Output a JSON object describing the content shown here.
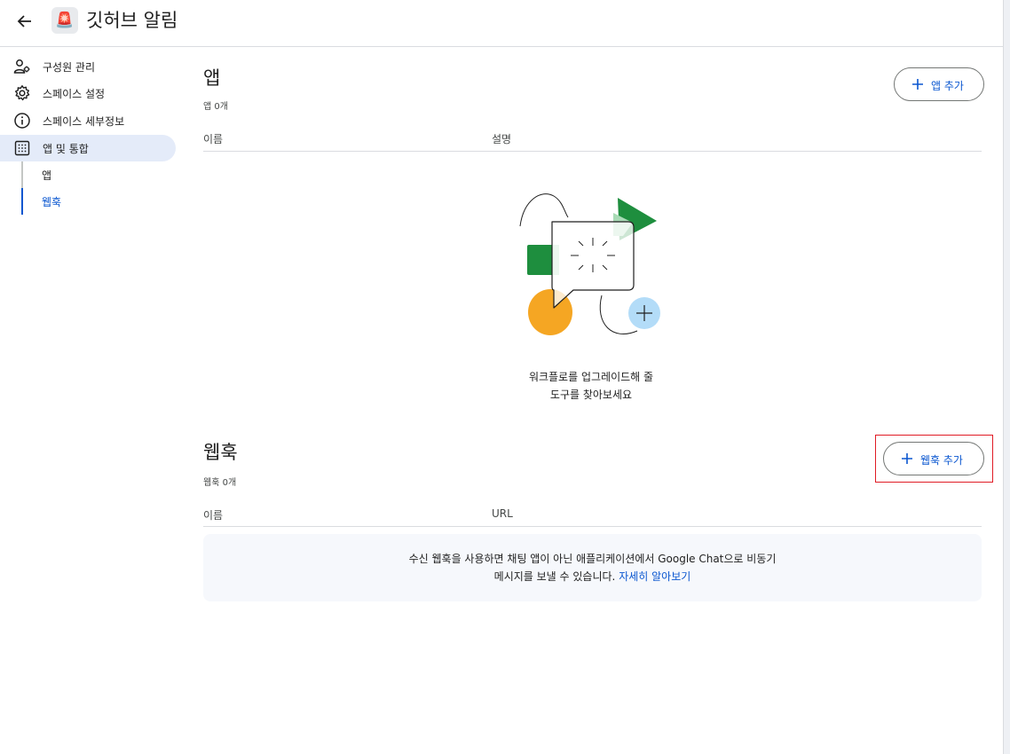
{
  "header": {
    "back_icon": "arrow-left-icon",
    "space_emoji": "🚨",
    "title": "깃허브 알림"
  },
  "sidebar": {
    "items": [
      {
        "label": "구성원 관리",
        "icon": "people-icon"
      },
      {
        "label": "스페이스 설정",
        "icon": "gear-icon"
      },
      {
        "label": "스페이스 세부정보",
        "icon": "info-icon"
      },
      {
        "label": "앱 및 통합",
        "icon": "apps-grid-icon",
        "active": true
      }
    ],
    "sub_items": [
      {
        "label": "앱"
      },
      {
        "label": "웹훅",
        "active": true
      }
    ]
  },
  "apps_section": {
    "title": "앱",
    "count": "앱 0개",
    "add_button": "앱 추가",
    "columns": [
      "이름",
      "설명"
    ],
    "empty_line1": "워크플로를 업그레이드해 줄",
    "empty_line2": "도구를 찾아보세요"
  },
  "webhooks_section": {
    "title": "웹훅",
    "count": "웹훅 0개",
    "add_button": "웹훅 추가",
    "columns": [
      "이름",
      "URL"
    ],
    "info_line1": "수신 웹훅을 사용하면 채팅 앱이 아닌 애플리케이션에서 Google Chat으로 비동기",
    "info_line2": "메시지를 보낼 수 있습니다.",
    "info_link": "자세히 알아보기"
  },
  "colors": {
    "accent": "#0b57d0",
    "active_bg": "#e4ebf9",
    "highlight": "#e01b24",
    "illus_green": "#1e8e3e",
    "illus_yellow": "#f5a623",
    "illus_blue": "#b3dcf8"
  }
}
